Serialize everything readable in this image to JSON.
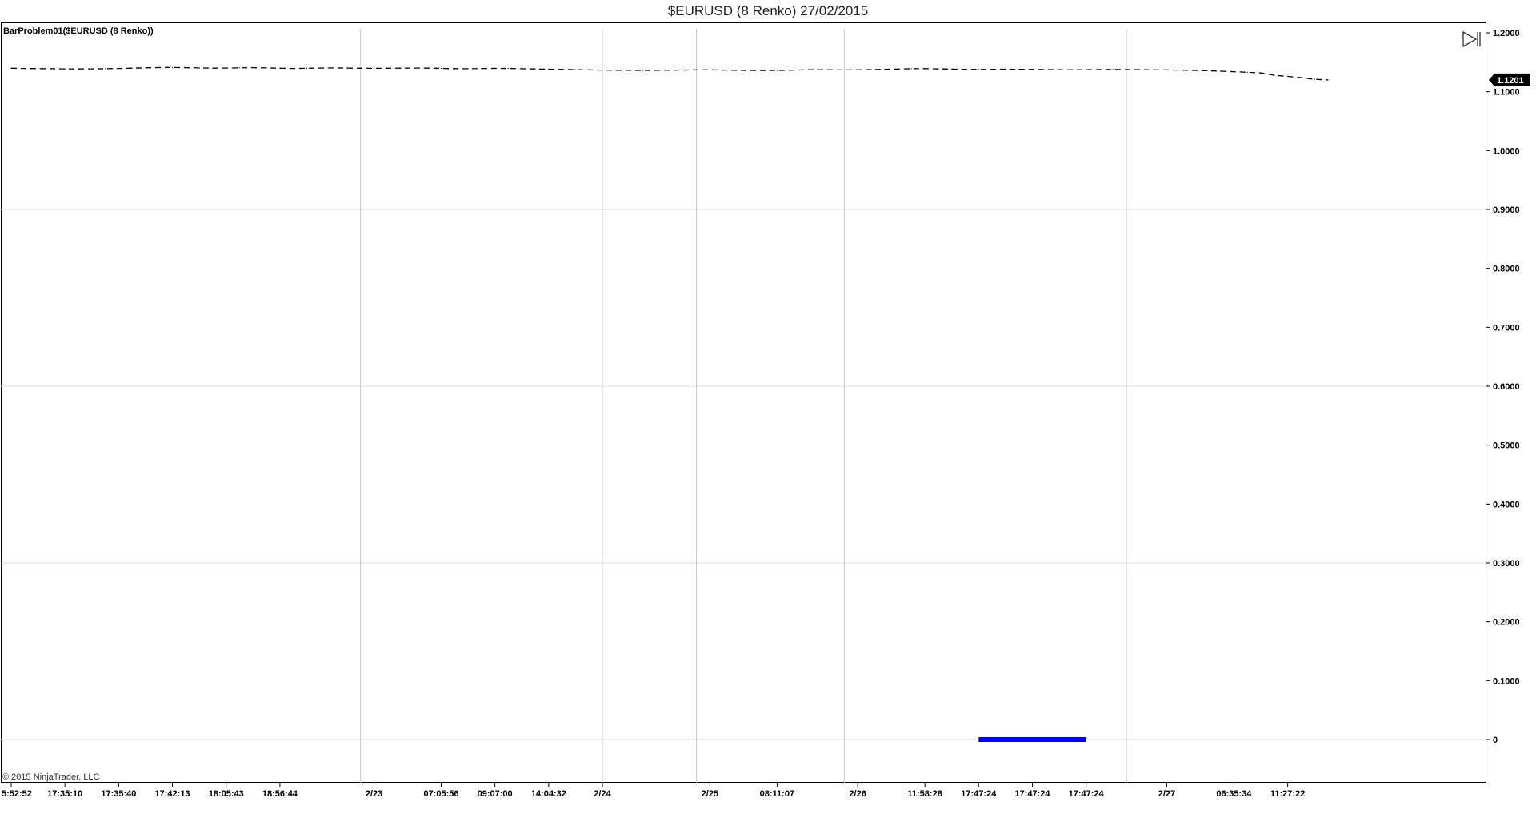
{
  "title": "$EURUSD (8 Renko)  27/02/2015",
  "indicator_label": "BarProblem01($EURUSD (8 Renko))",
  "copyright": "© 2015 NinjaTrader, LLC",
  "icons": {
    "scroll_to_end": "scroll-to-end-icon"
  },
  "colors": {
    "line": "#000000",
    "bar": "#0000ff",
    "grid": "#dcdcdc",
    "badge": "#000000"
  },
  "chart_data": {
    "type": "line",
    "ylim": [
      0,
      1.2
    ],
    "y_ticks": [
      "1.2000",
      "1.1000",
      "1.0000",
      "0.9000",
      "0.8000",
      "0.7000",
      "0.6000",
      "0.5000",
      "0.4000",
      "0.3000",
      "0.2000",
      "0.1000",
      "0"
    ],
    "y_tick_values": [
      1.2,
      1.1,
      1.0,
      0.9,
      0.8,
      0.7,
      0.6,
      0.5,
      0.4,
      0.3,
      0.2,
      0.1,
      0
    ],
    "x_labels": [
      "5:52:52",
      "17:35:10",
      "17:35:40",
      "17:42:13",
      "18:05:43",
      "18:56:44",
      "2/23",
      "07:05:56",
      "09:07:00",
      "14:04:32",
      "2/24",
      "2/25",
      "08:11:07",
      "2/26",
      "11:58:28",
      "17:47:24",
      "17:47:24",
      "17:47:24",
      "2/27",
      "06:35:34",
      "11:27:22"
    ],
    "x_label_index": [
      0,
      4,
      8,
      12,
      16,
      20,
      27,
      32,
      36,
      40,
      44,
      52,
      57,
      63,
      68,
      72,
      76,
      80,
      86,
      91,
      95
    ],
    "day_separators_index": [
      26,
      44,
      51,
      62,
      83
    ],
    "n_bars": 99,
    "series": [
      {
        "style": "dashed",
        "values": [
          1.1398,
          1.1395,
          1.1392,
          1.139,
          1.1388,
          1.1386,
          1.1388,
          1.139,
          1.1395,
          1.14,
          1.1405,
          1.141,
          1.1412,
          1.1408,
          1.1404,
          1.14,
          1.1402,
          1.1406,
          1.1408,
          1.1404,
          1.1398,
          1.1395,
          1.1398,
          1.1402,
          1.1404,
          1.1401,
          1.1398,
          1.1397,
          1.1398,
          1.14,
          1.1402,
          1.14,
          1.1396,
          1.1392,
          1.139,
          1.1393,
          1.1396,
          1.1394,
          1.139,
          1.1386,
          1.1382,
          1.1378,
          1.1374,
          1.137,
          1.1368,
          1.1365,
          1.1363,
          1.1362,
          1.1364,
          1.1366,
          1.1368,
          1.137,
          1.1372,
          1.1368,
          1.1364,
          1.1362,
          1.136,
          1.1362,
          1.1366,
          1.137,
          1.1374,
          1.1372,
          1.137,
          1.1372,
          1.1376,
          1.138,
          1.1385,
          1.139,
          1.1392,
          1.1388,
          1.1384,
          1.138,
          1.1378,
          1.138,
          1.1382,
          1.138,
          1.1378,
          1.1375,
          1.1374,
          1.1372,
          1.1374,
          1.1376,
          1.1378,
          1.1376,
          1.1374,
          1.1372,
          1.137,
          1.1366,
          1.1362,
          1.1356,
          1.1348,
          1.134,
          1.133,
          1.132,
          1.128,
          1.126,
          1.124,
          1.121,
          1.1201
        ],
        "last_value_label": "1.1201"
      }
    ],
    "bar_marker": {
      "value": 0,
      "x_start_index": 72,
      "x_end_index": 80
    }
  }
}
